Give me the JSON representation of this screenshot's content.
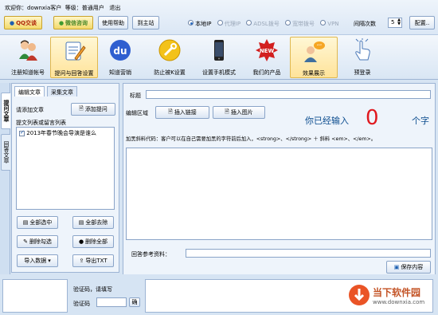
{
  "header": {
    "welcome_prefix": "欢迎你：",
    "username": "downxia客户",
    "level_label": "等级：",
    "level": "普通用户",
    "logout": "退出"
  },
  "toolbar": {
    "qq": "QQ交谈",
    "wechat": "微信咨询",
    "help": "使用帮助",
    "official_site": "到主站",
    "radio_local": "本地IP",
    "radio_proxy": "代理IP",
    "radio_adsl": "ADSL拨号",
    "radio_dial": "宽带拨号",
    "radio_vpn": "VPN",
    "interval_label": "间隔次数",
    "interval_value": "5",
    "config": "配置.."
  },
  "icons": [
    {
      "name": "register",
      "label": "注册知道帐号"
    },
    {
      "name": "question-answer",
      "label": "提问与回答设置"
    },
    {
      "name": "baidu",
      "label": "知道营销"
    },
    {
      "name": "anti-k",
      "label": "防止被K设置"
    },
    {
      "name": "phone-mode",
      "label": "设置手机模式"
    },
    {
      "name": "our-products",
      "label": "我们的产品"
    },
    {
      "name": "effect-show",
      "label": "效果展示"
    },
    {
      "name": "prelogin",
      "label": "预登录"
    }
  ],
  "vtabs": [
    "提问文章",
    "回答文章"
  ],
  "left": {
    "tab_edit": "编辑文章",
    "tab_collect": "采集文章",
    "add_label": "请添加文章",
    "add_button": "添加提问",
    "list_header": "提文列表或留言列表",
    "items": [
      {
        "text": "2013年春节晚会导演是谁么",
        "checked": true
      }
    ],
    "btn_select_all": "全部选中",
    "btn_remove_all": "全部去除",
    "btn_delete_checked": "删除勾选",
    "btn_delete_all": "删除全部",
    "btn_import": "导入数据",
    "btn_export": "导出TXT"
  },
  "right": {
    "title_label": "标题",
    "edit_area_label": "编辑区域",
    "insert_link": "插入链接",
    "insert_image": "插入图片",
    "counter_prefix": "你已经输入",
    "counter_value": "0",
    "counter_suffix": "个字",
    "bold_hint": "加黑斜料代码：客户可以在自己需要加黑的字符前后加入，<strong>、</strong> ＋ 斜料 <em>、</em>。",
    "reference_label": "回答参考资料：",
    "save_button": "保存内容"
  },
  "bottom": {
    "captcha_hint": "验证码，请填写",
    "captcha_label": "验证码",
    "captcha_ok": "确"
  },
  "watermark": {
    "title": "当下软件园",
    "url": "www.downxia.com"
  },
  "colors": {
    "accent": "#e0191f",
    "header_blue": "#0c4d8f",
    "panel": "#eef4fb"
  }
}
